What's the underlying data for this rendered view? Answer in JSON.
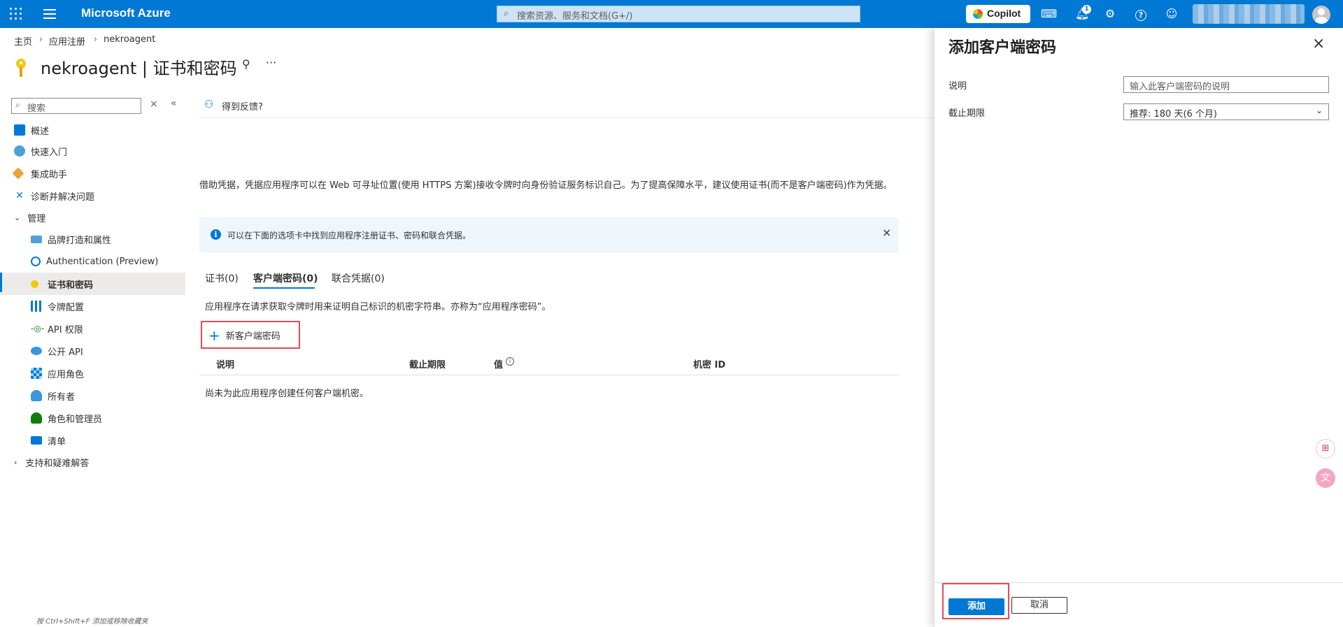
{
  "topbar": {
    "brand": "Microsoft Azure",
    "search_placeholder": "搜索资源、服务和文档(G+/)",
    "copilot_label": "Copilot",
    "notification_count": "1"
  },
  "breadcrumb": {
    "home": "主页",
    "app_reg": "应用注册",
    "app": "nekroagent"
  },
  "page": {
    "title": "nekroagent | 证书和密码"
  },
  "nav": {
    "search_placeholder": "搜索",
    "items": [
      {
        "label": "概述",
        "color": "#0078d4"
      },
      {
        "label": "快速入门",
        "color": "#50a0d8"
      },
      {
        "label": "集成助手",
        "color": "#e8a33d"
      },
      {
        "label": "诊断并解决问题",
        "color": "#0078d4"
      },
      {
        "label": "管理"
      },
      {
        "label": "品牌打造和属性",
        "color": "#50a0d8"
      },
      {
        "label": "Authentication (Preview)",
        "color": "#0078d4"
      },
      {
        "label": "证书和密码",
        "color": "#f2c811"
      },
      {
        "label": "令牌配置",
        "color": "#0078d4"
      },
      {
        "label": "API 权限",
        "color": "#107c10"
      },
      {
        "label": "公开 API",
        "color": "#3a96dd"
      },
      {
        "label": "应用角色",
        "color": "#0078d4"
      },
      {
        "label": "所有者",
        "color": "#3a96dd"
      },
      {
        "label": "角色和管理员",
        "color": "#107c10"
      },
      {
        "label": "清单",
        "color": "#0078d4"
      },
      {
        "label": "支持和疑难解答"
      }
    ],
    "footer_hint": "按 Ctrl+Shift+F 添加或移除收藏夹"
  },
  "main": {
    "feedback": "得到反馈?",
    "description": "借助凭据，凭据应用程序可以在 Web 可寻址位置(使用 HTTPS 方案)接收令牌时向身份验证服务标识自己。为了提高保障水平，建议使用证书(而不是客户端密码)作为凭据。",
    "info": "可以在下面的选项卡中找到应用程序注册证书、密码和联合凭据。",
    "tabs": [
      "证书(0)",
      "客户端密码(0)",
      "联合凭据(0)"
    ],
    "tab_description": "应用程序在请求获取令牌时用来证明自己标识的机密字符串。亦称为“应用程序密码”。",
    "new_secret_button": "新客户端密码",
    "columns": [
      "说明",
      "截止期限",
      "值",
      "机密 ID"
    ],
    "empty_text": "尚未为此应用程序创建任何客户端机密。"
  },
  "panel": {
    "title": "添加客户端密码",
    "desc_label": "说明",
    "desc_placeholder": "输入此客户端密码的说明",
    "expiry_label": "截止期限",
    "expiry_value": "推荐: 180 天(6 个月)",
    "add_button": "添加",
    "cancel_button": "取消"
  },
  "colors": {
    "accent": "#0078d4",
    "highlight": "#e74856"
  }
}
